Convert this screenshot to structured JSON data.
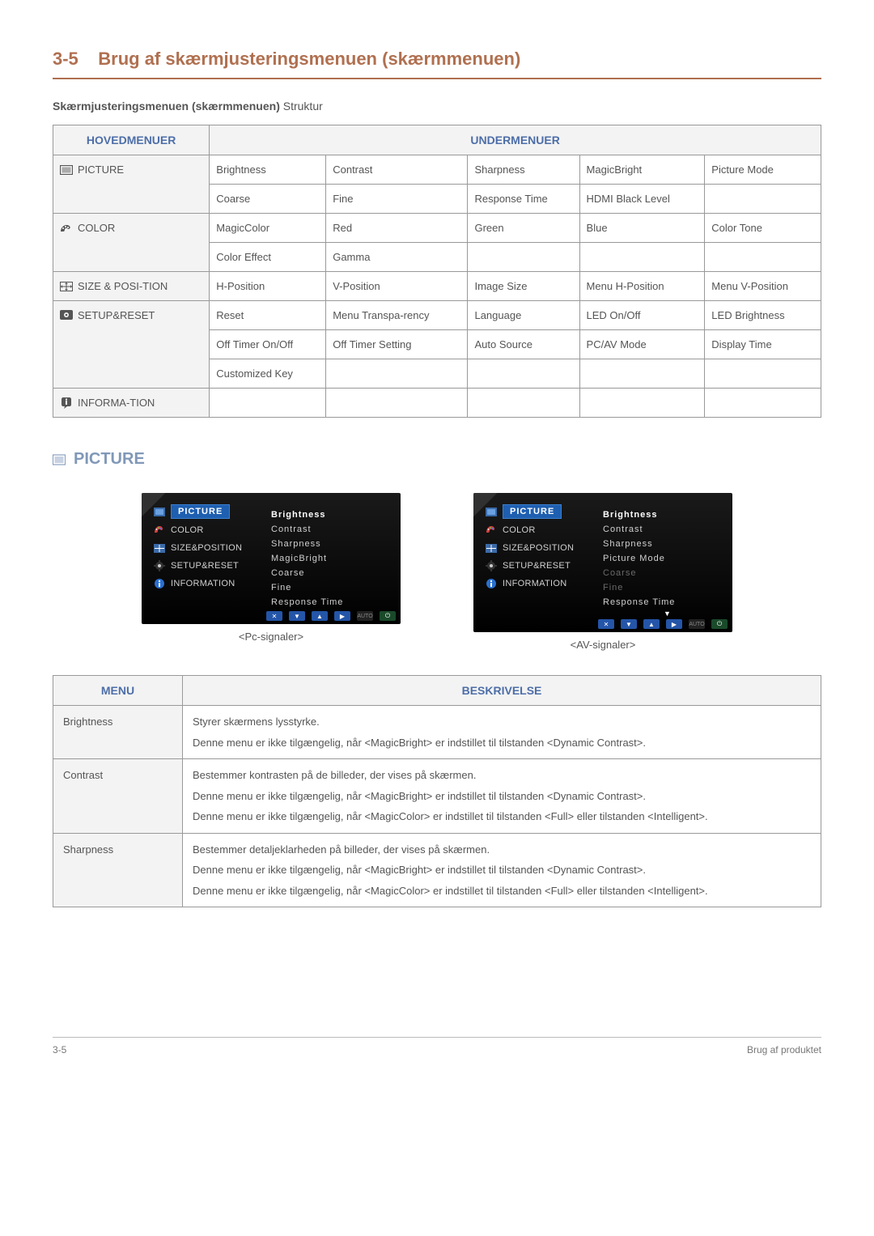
{
  "section": {
    "number": "3-5",
    "title": "Brug af skærmjusteringsmenuen (skærmmenuen)"
  },
  "subtitle_bold": "Skærmjusteringsmenuen (skærmmenuen)",
  "subtitle_rest": " Struktur",
  "table1": {
    "header_main": "HOVEDMENUER",
    "header_sub": "UNDERMENUER",
    "rows": {
      "picture": {
        "label": "PICTURE",
        "r1": [
          "Brightness",
          "Contrast",
          "Sharpness",
          "MagicBright",
          "Picture Mode"
        ],
        "r2": [
          "Coarse",
          "Fine",
          "Response Time",
          "HDMI Black Level",
          ""
        ]
      },
      "color": {
        "label": "COLOR",
        "r1": [
          "MagicColor",
          "Red",
          "Green",
          "Blue",
          "Color Tone"
        ],
        "r2": [
          "Color Effect",
          "Gamma",
          "",
          "",
          ""
        ]
      },
      "size": {
        "label": "SIZE & POSI-TION",
        "r1": [
          "H-Position",
          "V-Position",
          "Image Size",
          "Menu H-Position",
          "Menu V-Position"
        ]
      },
      "setup": {
        "label": "SETUP&RESET",
        "r1": [
          "Reset",
          "Menu Transpa-rency",
          "Language",
          "LED On/Off",
          "LED Brightness"
        ],
        "r2": [
          "Off Timer On/Off",
          "Off Timer Setting",
          "Auto Source",
          "PC/AV Mode",
          "Display Time"
        ],
        "r3": [
          "Customized Key",
          "",
          "",
          "",
          ""
        ]
      },
      "info": {
        "label": "INFORMA-TION",
        "r1": [
          "",
          "",
          "",
          "",
          ""
        ]
      }
    }
  },
  "picture_heading": "PICTURE",
  "osd": {
    "left_items": [
      "PICTURE",
      "COLOR",
      "SIZE&POSITION",
      "SETUP&RESET",
      "INFORMATION"
    ],
    "pc": {
      "caption": "<Pc-signaler>",
      "right": [
        {
          "t": "Brightness",
          "cls": "sel"
        },
        {
          "t": "Contrast",
          "cls": ""
        },
        {
          "t": "Sharpness",
          "cls": ""
        },
        {
          "t": "MagicBright",
          "cls": ""
        },
        {
          "t": "Coarse",
          "cls": ""
        },
        {
          "t": "Fine",
          "cls": ""
        },
        {
          "t": "Response Time",
          "cls": ""
        }
      ]
    },
    "av": {
      "caption": "<AV-signaler>",
      "right": [
        {
          "t": "Brightness",
          "cls": "sel"
        },
        {
          "t": "Contrast",
          "cls": ""
        },
        {
          "t": "Sharpness",
          "cls": ""
        },
        {
          "t": "Picture Mode",
          "cls": ""
        },
        {
          "t": "Coarse",
          "cls": "dim"
        },
        {
          "t": "Fine",
          "cls": "dim"
        },
        {
          "t": "Response Time",
          "cls": ""
        }
      ]
    },
    "btn_auto": "AUTO"
  },
  "desc": {
    "header_menu": "MENU",
    "header_desc": "BESKRIVELSE",
    "rows": [
      {
        "name": "Brightness",
        "lines": [
          "Styrer skærmens lysstyrke.",
          "Denne menu er ikke tilgængelig, når <MagicBright> er indstillet til tilstanden <Dynamic Contrast>."
        ]
      },
      {
        "name": "Contrast",
        "lines": [
          "Bestemmer kontrasten på de billeder, der vises på skærmen.",
          "Denne menu er ikke tilgængelig, når <MagicBright> er indstillet til tilstanden <Dynamic Contrast>.",
          "Denne menu er ikke tilgængelig, når <MagicColor> er indstillet til tilstanden <Full> eller tilstanden <Intelligent>."
        ]
      },
      {
        "name": "Sharpness",
        "lines": [
          "Bestemmer detaljeklarheden på billeder, der vises på skærmen.",
          "Denne menu er ikke tilgængelig, når <MagicBright> er indstillet til tilstanden <Dynamic Contrast>.",
          "Denne menu er ikke tilgængelig, når <MagicColor> er indstillet til tilstanden <Full> eller tilstanden <Intelligent>."
        ]
      }
    ]
  },
  "footer": {
    "left": "3-5",
    "right": "Brug af produktet"
  }
}
